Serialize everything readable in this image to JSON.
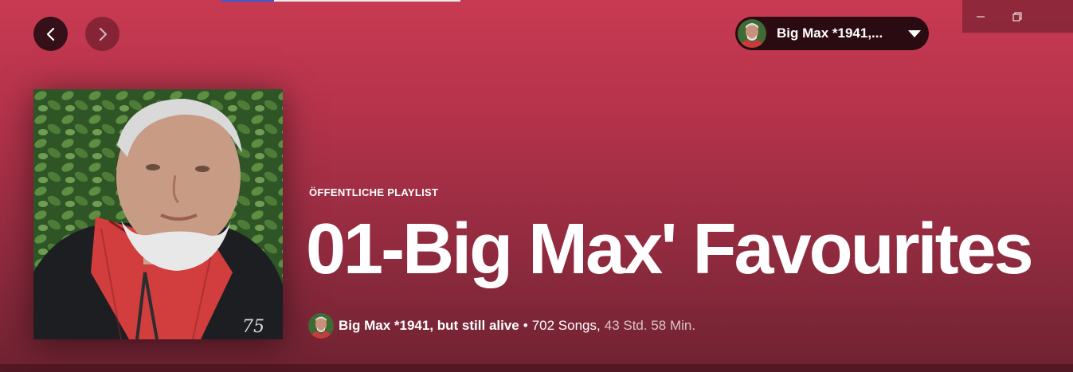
{
  "header": {
    "nav_back_icon": "chevron-left-icon",
    "nav_forward_icon": "chevron-right-icon",
    "user_display_name": "Big Max *1941,...",
    "user_menu_icon": "caret-down-icon"
  },
  "window_controls": {
    "minimize_icon": "minimize-icon",
    "restore_icon": "restore-icon"
  },
  "playlist": {
    "type_label": "ÖFFENTLICHE PLAYLIST",
    "title": "01-Big Max' Favourites",
    "owner": "Big Max *1941, but still alive",
    "separator": "•",
    "song_count": "702 Songs,",
    "duration": "43 Std. 58 Min.",
    "cover_badge": "75"
  },
  "colors": {
    "background_top": "#c83a52",
    "background_bottom": "#6e2231",
    "pill_background": "#2a0b12"
  }
}
